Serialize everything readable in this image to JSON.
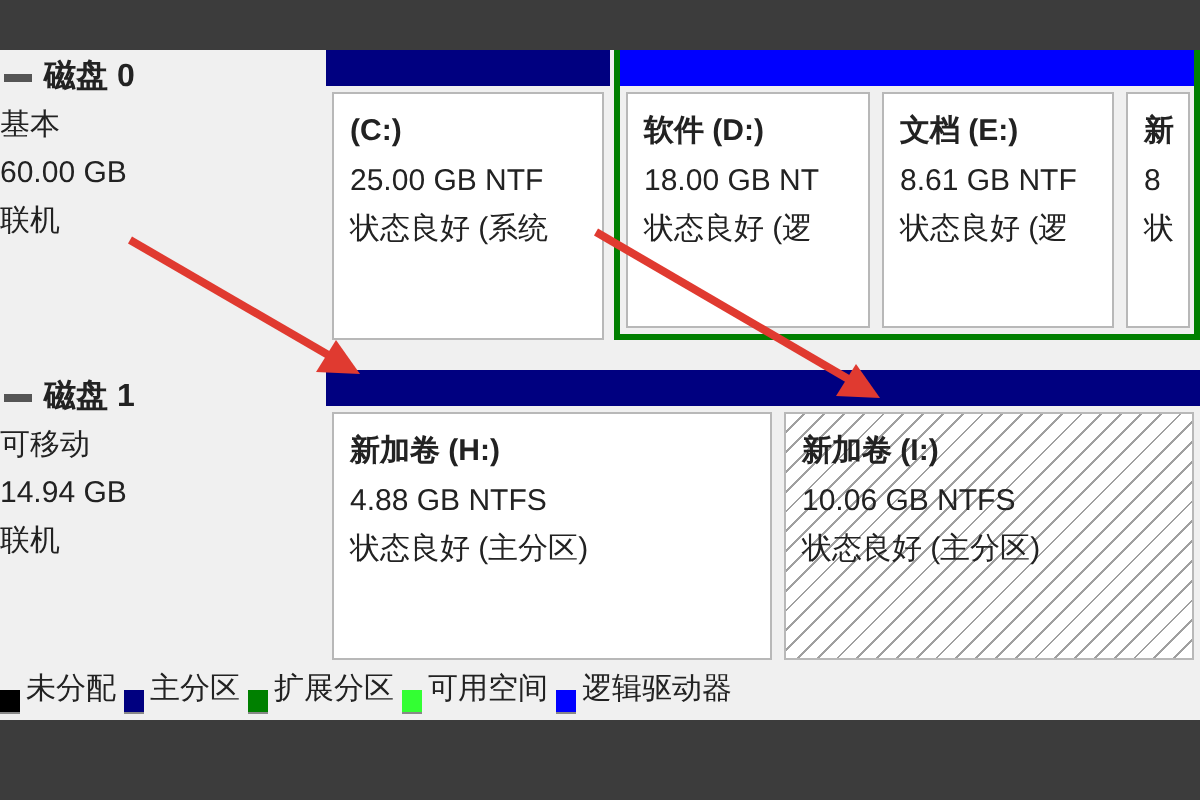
{
  "disks": [
    {
      "name": "磁盘 0",
      "type": "基本",
      "size": "60.00 GB",
      "status": "联机",
      "partitions": [
        {
          "kind": "primary",
          "selected": false,
          "name": "(C:)",
          "size": "25.00 GB NTF",
          "status": "状态良好 (系统"
        },
        {
          "kind": "logical",
          "selected": false,
          "name": "软件 (D:)",
          "size": "18.00 GB NT",
          "status": "状态良好 (逻"
        },
        {
          "kind": "logical",
          "selected": false,
          "name": "文档 (E:)",
          "size": "8.61 GB NTF",
          "status": "状态良好 (逻"
        },
        {
          "kind": "logical",
          "selected": false,
          "name": "新",
          "size": "8",
          "status": "状"
        }
      ]
    },
    {
      "name": "磁盘 1",
      "type": "可移动",
      "size": "14.94 GB",
      "status": "联机",
      "partitions": [
        {
          "kind": "primary",
          "selected": false,
          "name": "新加卷 (H:)",
          "size": "4.88 GB NTFS",
          "status": "状态良好 (主分区)"
        },
        {
          "kind": "primary",
          "selected": true,
          "name": "新加卷 (I:)",
          "size": "10.06 GB NTFS",
          "status": "状态良好 (主分区)"
        }
      ]
    }
  ],
  "legend": [
    {
      "label": "未分配",
      "color": "#000000"
    },
    {
      "label": "主分区",
      "color": "#000080"
    },
    {
      "label": "扩展分区",
      "color": "#008000"
    },
    {
      "label": "可用空间",
      "color": "#33ff33"
    },
    {
      "label": "逻辑驱动器",
      "color": "#0000ff"
    }
  ]
}
